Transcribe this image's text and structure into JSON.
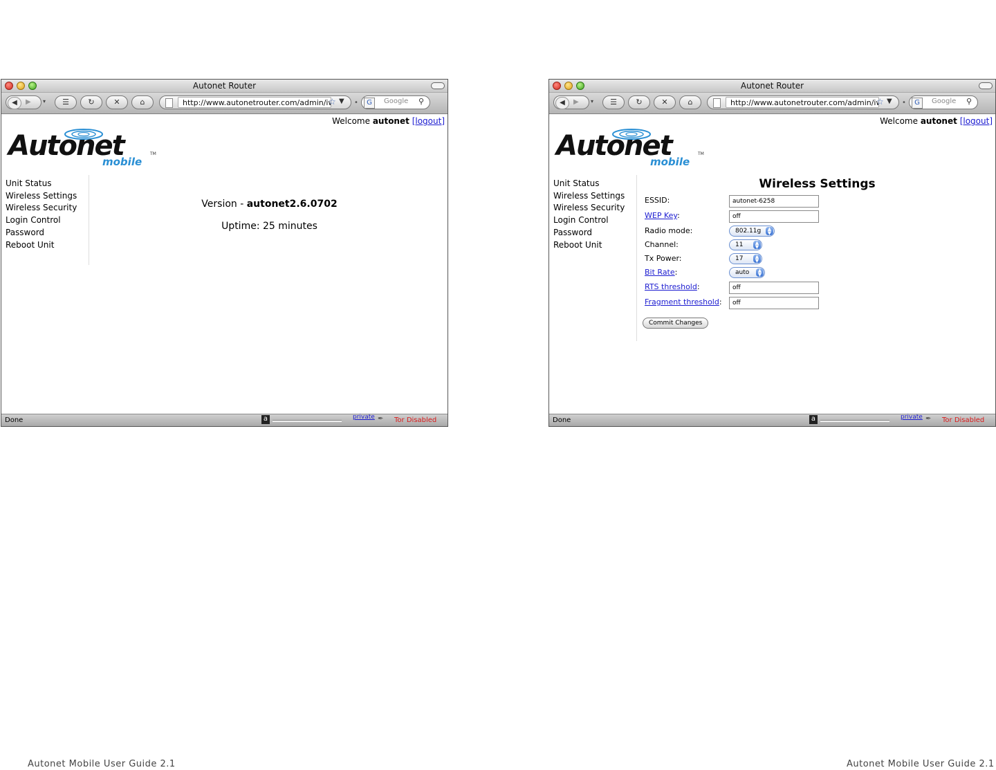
{
  "footer": {
    "left": "Autonet Mobile User Guide 2.1",
    "right": "Autonet Mobile User Guide 2.1"
  },
  "browser": {
    "title": "Autonet Router",
    "url": "http://www.autonetrouter.com/admin/iw",
    "search_placeholder": "Google",
    "status_done": "Done",
    "status_private": "private",
    "status_tor": "Tor Disabled"
  },
  "page": {
    "welcome_prefix": "Welcome",
    "username": "autonet",
    "logout_label": "[logout]",
    "logo": {
      "word": "Autonet",
      "sub": "mobile",
      "tm": "TM"
    },
    "nav": [
      "Unit Status",
      "Wireless Settings",
      "Wireless Security",
      "Login Control",
      "Password",
      "Reboot Unit"
    ]
  },
  "status_screen": {
    "version_prefix": "Version - ",
    "version_value": "autonet2.6.0702",
    "uptime": "Uptime: 25 minutes"
  },
  "wireless_screen": {
    "title": "Wireless Settings",
    "fields": {
      "essid": {
        "label": "ESSID:",
        "value": "autonet-6258"
      },
      "wep_key": {
        "label": "WEP Key",
        "suffix": ":",
        "value": "off"
      },
      "radio_mode": {
        "label": "Radio mode:",
        "value": "802.11g"
      },
      "channel": {
        "label": "Channel:",
        "value": "11"
      },
      "tx_power": {
        "label": "Tx Power:",
        "value": "17"
      },
      "bit_rate": {
        "label": "Bit Rate",
        "suffix": ":",
        "value": "auto"
      },
      "rts_threshold": {
        "label": "RTS threshold",
        "suffix": ":",
        "value": "off"
      },
      "fragment_threshold": {
        "label": "Fragment threshold",
        "suffix": ":",
        "value": "off"
      }
    },
    "commit_label": "Commit Changes"
  }
}
